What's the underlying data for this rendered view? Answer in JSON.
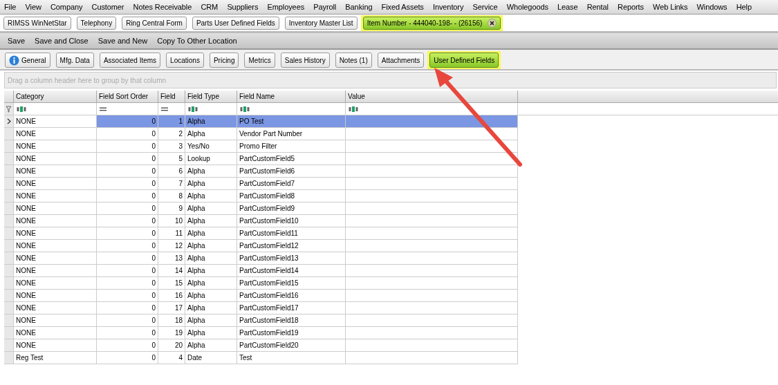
{
  "menu_bar": [
    "File",
    "View",
    "Company",
    "Customer",
    "Notes Receivable",
    "CRM",
    "Suppliers",
    "Employees",
    "Payroll",
    "Banking",
    "Fixed Assets",
    "Inventory",
    "Service",
    "Wholegoods",
    "Lease",
    "Rental",
    "Reports",
    "Web Links",
    "Windows",
    "Help"
  ],
  "open_tabs": [
    {
      "label": "RIMSS WinNetStar",
      "selected": false,
      "highlighted": false,
      "closable": false
    },
    {
      "label": "Telephony",
      "selected": false,
      "highlighted": false,
      "closable": false
    },
    {
      "label": "Ring Central Form",
      "selected": false,
      "highlighted": false,
      "closable": false
    },
    {
      "label": "Parts User Defined Fields",
      "selected": false,
      "highlighted": false,
      "closable": false
    },
    {
      "label": "Inventory Master List",
      "selected": false,
      "highlighted": false,
      "closable": false
    },
    {
      "label": "Item Number - 444040-198- - (26156)",
      "selected": true,
      "highlighted": true,
      "closable": true
    }
  ],
  "toolbar": [
    "Save",
    "Save and Close",
    "Save and New",
    "Copy To Other Location"
  ],
  "detail_tabs": [
    {
      "label": "General",
      "selected": false,
      "highlighted": false,
      "info_icon": true
    },
    {
      "label": "Mfg. Data",
      "selected": false,
      "highlighted": false,
      "info_icon": false
    },
    {
      "label": "Associated Items",
      "selected": false,
      "highlighted": false,
      "info_icon": false
    },
    {
      "label": "Locations",
      "selected": false,
      "highlighted": false,
      "info_icon": false
    },
    {
      "label": "Pricing",
      "selected": false,
      "highlighted": false,
      "info_icon": false
    },
    {
      "label": "Metrics",
      "selected": false,
      "highlighted": false,
      "info_icon": false
    },
    {
      "label": "Sales History",
      "selected": false,
      "highlighted": false,
      "info_icon": false
    },
    {
      "label": "Notes (1)",
      "selected": false,
      "highlighted": false,
      "info_icon": false
    },
    {
      "label": "Attachments",
      "selected": false,
      "highlighted": false,
      "info_icon": false
    },
    {
      "label": "User Defined Fields",
      "selected": true,
      "highlighted": true,
      "info_icon": false
    }
  ],
  "group_panel": {
    "placeholder": "Drag a column header here to group by that column"
  },
  "grid": {
    "columns": [
      {
        "label": "Category",
        "numeric": false
      },
      {
        "label": "Field Sort Order",
        "numeric": true
      },
      {
        "label": "Field",
        "numeric": true
      },
      {
        "label": "Field Type",
        "numeric": false
      },
      {
        "label": "Field Name",
        "numeric": false
      },
      {
        "label": "Value",
        "numeric": false
      }
    ],
    "rows": [
      {
        "selected": true,
        "cells": [
          "NONE",
          "0",
          "1",
          "Alpha",
          "PO Test",
          ""
        ]
      },
      {
        "selected": false,
        "cells": [
          "NONE",
          "0",
          "2",
          "Alpha",
          "Vendor Part Number",
          ""
        ]
      },
      {
        "selected": false,
        "cells": [
          "NONE",
          "0",
          "3",
          "Yes/No",
          "Promo Filter",
          ""
        ]
      },
      {
        "selected": false,
        "cells": [
          "NONE",
          "0",
          "5",
          "Lookup",
          "PartCustomField5",
          ""
        ]
      },
      {
        "selected": false,
        "cells": [
          "NONE",
          "0",
          "6",
          "Alpha",
          "PartCustomField6",
          ""
        ]
      },
      {
        "selected": false,
        "cells": [
          "NONE",
          "0",
          "7",
          "Alpha",
          "PartCustomField7",
          ""
        ]
      },
      {
        "selected": false,
        "cells": [
          "NONE",
          "0",
          "8",
          "Alpha",
          "PartCustomField8",
          ""
        ]
      },
      {
        "selected": false,
        "cells": [
          "NONE",
          "0",
          "9",
          "Alpha",
          "PartCustomField9",
          ""
        ]
      },
      {
        "selected": false,
        "cells": [
          "NONE",
          "0",
          "10",
          "Alpha",
          "PartCustomField10",
          ""
        ]
      },
      {
        "selected": false,
        "cells": [
          "NONE",
          "0",
          "11",
          "Alpha",
          "PartCustomField11",
          ""
        ]
      },
      {
        "selected": false,
        "cells": [
          "NONE",
          "0",
          "12",
          "Alpha",
          "PartCustomField12",
          ""
        ]
      },
      {
        "selected": false,
        "cells": [
          "NONE",
          "0",
          "13",
          "Alpha",
          "PartCustomField13",
          ""
        ]
      },
      {
        "selected": false,
        "cells": [
          "NONE",
          "0",
          "14",
          "Alpha",
          "PartCustomField14",
          ""
        ]
      },
      {
        "selected": false,
        "cells": [
          "NONE",
          "0",
          "15",
          "Alpha",
          "PartCustomField15",
          ""
        ]
      },
      {
        "selected": false,
        "cells": [
          "NONE",
          "0",
          "16",
          "Alpha",
          "PartCustomField16",
          ""
        ]
      },
      {
        "selected": false,
        "cells": [
          "NONE",
          "0",
          "17",
          "Alpha",
          "PartCustomField17",
          ""
        ]
      },
      {
        "selected": false,
        "cells": [
          "NONE",
          "0",
          "18",
          "Alpha",
          "PartCustomField18",
          ""
        ]
      },
      {
        "selected": false,
        "cells": [
          "NONE",
          "0",
          "19",
          "Alpha",
          "PartCustomField19",
          ""
        ]
      },
      {
        "selected": false,
        "cells": [
          "NONE",
          "0",
          "20",
          "Alpha",
          "PartCustomField20",
          ""
        ]
      },
      {
        "selected": false,
        "cells": [
          "Reg Test",
          "0",
          "4",
          "Date",
          "Test",
          ""
        ]
      }
    ]
  },
  "annotation": {
    "kind": "arrow",
    "color": "#e8473d"
  }
}
